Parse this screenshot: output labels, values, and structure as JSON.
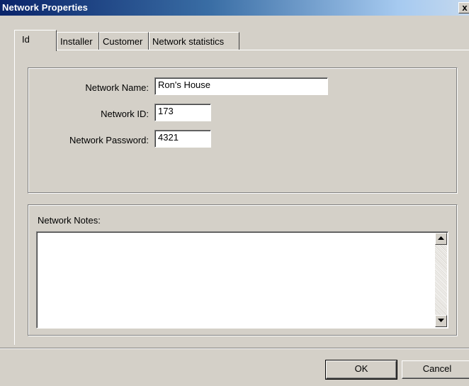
{
  "window": {
    "title": "Network Properties",
    "close_label": "x"
  },
  "tabs": [
    {
      "label": "Id",
      "active": true
    },
    {
      "label": "Installer",
      "active": false
    },
    {
      "label": "Customer",
      "active": false
    },
    {
      "label": "Network statistics",
      "active": false
    }
  ],
  "id_panel": {
    "network_name": {
      "label": "Network Name:",
      "value": "Ron's House"
    },
    "network_id": {
      "label": "Network ID:",
      "value": "173"
    },
    "network_password": {
      "label": "Network Password:",
      "value": "4321"
    }
  },
  "notes": {
    "label": "Network Notes:",
    "value": ""
  },
  "buttons": {
    "ok": "OK",
    "cancel": "Cancel"
  },
  "icons": {
    "scroll_up": "triangle-up-icon",
    "scroll_down": "triangle-down-icon",
    "close": "close-icon"
  }
}
